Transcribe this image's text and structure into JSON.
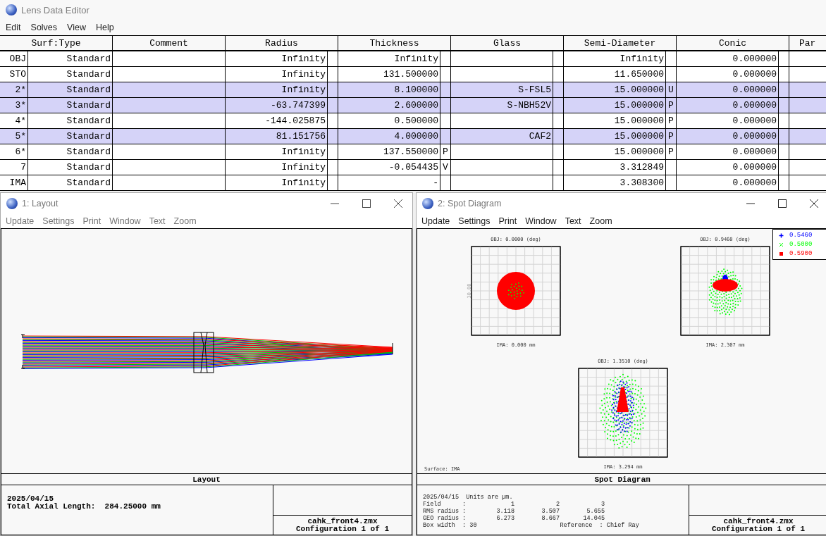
{
  "window": {
    "title": "Lens Data Editor"
  },
  "menu": [
    "Edit",
    "Solves",
    "View",
    "Help"
  ],
  "table": {
    "columns": [
      "Surf:Type",
      "Comment",
      "Radius",
      "Thickness",
      "Glass",
      "Semi-Diameter",
      "Conic",
      "Par"
    ],
    "rows": [
      {
        "surface": "OBJ",
        "type": "Standard",
        "radius": "Infinity",
        "thickness": "Infinity",
        "semi_diameter": "Infinity",
        "conic": "0.000000",
        "selected": false
      },
      {
        "surface": "STO",
        "type": "Standard",
        "radius": "Infinity",
        "thickness": "131.500000",
        "semi_diameter": "11.650000",
        "conic": "0.000000",
        "selected": false
      },
      {
        "surface": "2*",
        "type": "Standard",
        "radius": "Infinity",
        "thickness": "8.100000",
        "glass": "S-FSL5",
        "semi_diameter": "15.000000",
        "semi_diameter_solve": "U",
        "conic": "0.000000",
        "selected": true
      },
      {
        "surface": "3*",
        "type": "Standard",
        "radius": "-63.747399",
        "thickness": "2.600000",
        "glass": "S-NBH52V",
        "semi_diameter": "15.000000",
        "semi_diameter_solve": "P",
        "conic": "0.000000",
        "selected": true
      },
      {
        "surface": "4*",
        "type": "Standard",
        "radius": "-144.025875",
        "thickness": "0.500000",
        "semi_diameter": "15.000000",
        "semi_diameter_solve": "P",
        "conic": "0.000000",
        "selected": false
      },
      {
        "surface": "5*",
        "type": "Standard",
        "radius": "81.151756",
        "thickness": "4.000000",
        "glass": "CAF2",
        "semi_diameter": "15.000000",
        "semi_diameter_solve": "P",
        "conic": "0.000000",
        "selected": true
      },
      {
        "surface": "6*",
        "type": "Standard",
        "radius": "Infinity",
        "thickness": "137.550000",
        "thickness_solve": "P",
        "semi_diameter": "15.000000",
        "semi_diameter_solve": "P",
        "conic": "0.000000",
        "selected": false
      },
      {
        "surface": "7",
        "type": "Standard",
        "radius": "Infinity",
        "thickness": "-0.054435",
        "thickness_solve": "V",
        "semi_diameter": "3.312849",
        "conic": "0.000000",
        "selected": false
      },
      {
        "surface": "IMA",
        "type": "Standard",
        "radius": "Infinity",
        "thickness": "-",
        "semi_diameter": "3.308300",
        "conic": "0.000000",
        "selected": false
      }
    ]
  },
  "layout_window": {
    "title": "1: Layout",
    "menu": [
      "Update",
      "Settings",
      "Print",
      "Window",
      "Text",
      "Zoom"
    ],
    "footer_title": "Layout",
    "info": [
      "2025/04/15",
      "Total Axial Length:  284.25000 mm"
    ],
    "file": "cahk_front4.zmx",
    "configuration": "Configuration 1 of 1"
  },
  "spot_window": {
    "title": "2: Spot Diagram",
    "menu": [
      "Update",
      "Settings",
      "Print",
      "Window",
      "Text",
      "Zoom"
    ],
    "plots": [
      {
        "obj": "OBJ: 0.0000 (deg)",
        "ima": "IMA: 0.000 mm"
      },
      {
        "obj": "OBJ: 0.9460 (deg)",
        "ima": "IMA: 2.307 mm"
      },
      {
        "obj": "OBJ: 1.3510 (deg)",
        "ima": "IMA: 3.294 mm"
      }
    ],
    "axis_label": "30.00",
    "legend": [
      {
        "label": "0.5460",
        "color": "#0000ff",
        "kind": "plus"
      },
      {
        "label": "0.5000",
        "color": "#00ff00",
        "kind": "cross"
      },
      {
        "label": "0.5900",
        "color": "#ff0000",
        "kind": "square"
      }
    ],
    "surface": "Surface: IMA",
    "footer_title": "Spot Diagram",
    "units": "2025/04/15  Units are µm.",
    "stats": [
      {
        "label": "Field",
        "sep": ":",
        "values": [
          "1",
          "2",
          "3"
        ]
      },
      {
        "label": "RMS radius",
        "sep": ":",
        "values": [
          "3.118",
          "3.507",
          "5.655"
        ]
      },
      {
        "label": "GEO radius",
        "sep": ":",
        "values": [
          "6.273",
          "8.667",
          "14.045"
        ]
      }
    ],
    "box_width": "Box width  : 30",
    "reference": "Reference  : Chief Ray",
    "file": "cahk_front4.zmx",
    "configuration": "Configuration 1 of 1"
  }
}
